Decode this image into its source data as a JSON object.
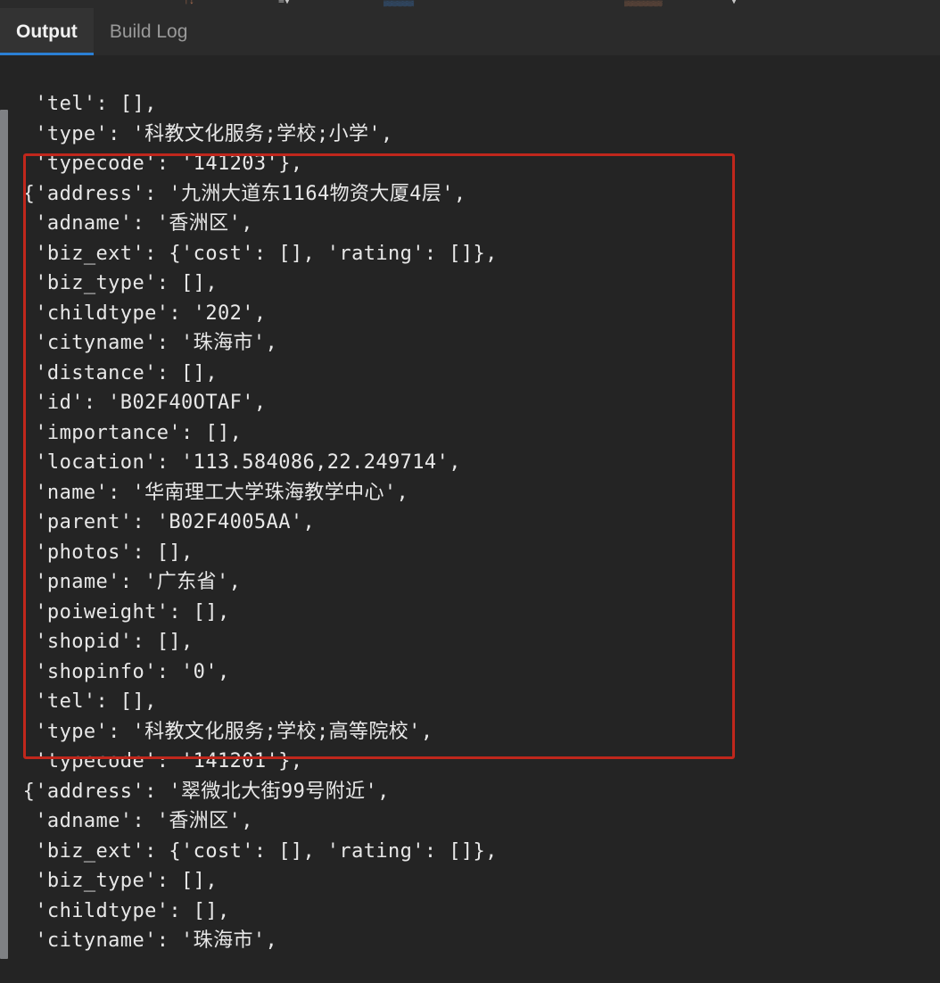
{
  "window": {
    "background_color": "#242424",
    "tabbar_color": "#2b2b2b",
    "accent_color": "#2b7fd4",
    "annotation_color": "#c0271c"
  },
  "toolbar_clipped": {
    "note": "partially cut-off toolbar row at top of screenshot",
    "fragments": [
      "↑↓",
      "≡▾",
      "▒▒▒▒",
      "▒▒▒▒▒",
      "▾"
    ]
  },
  "tabs": [
    {
      "label": "Output",
      "active": true
    },
    {
      "label": "Build Log",
      "active": false
    }
  ],
  "console": {
    "lines": [
      "  'tel': [],",
      "  'type': '科教文化服务;学校;小学',",
      "  'typecode': '141203'},",
      " {'address': '九洲大道东1164物资大厦4层',",
      "  'adname': '香洲区',",
      "  'biz_ext': {'cost': [], 'rating': []},",
      "  'biz_type': [],",
      "  'childtype': '202',",
      "  'cityname': '珠海市',",
      "  'distance': [],",
      "  'id': 'B02F40OTAF',",
      "  'importance': [],",
      "  'location': '113.584086,22.249714',",
      "  'name': '华南理工大学珠海教学中心',",
      "  'parent': 'B02F4005AA',",
      "  'photos': [],",
      "  'pname': '广东省',",
      "  'poiweight': [],",
      "  'shopid': [],",
      "  'shopinfo': '0',",
      "  'tel': [],",
      "  'type': '科教文化服务;学校;高等院校',",
      "  'typecode': '141201'},",
      " {'address': '翠微北大街99号附近',",
      "  'adname': '香洲区',",
      "  'biz_ext': {'cost': [], 'rating': []},",
      "  'biz_type': [],",
      "  'childtype': [],",
      "  'cityname': '珠海市',"
    ],
    "highlight": {
      "label": "red-annotation-box",
      "start_line_index": 3,
      "end_line_index": 22
    }
  }
}
